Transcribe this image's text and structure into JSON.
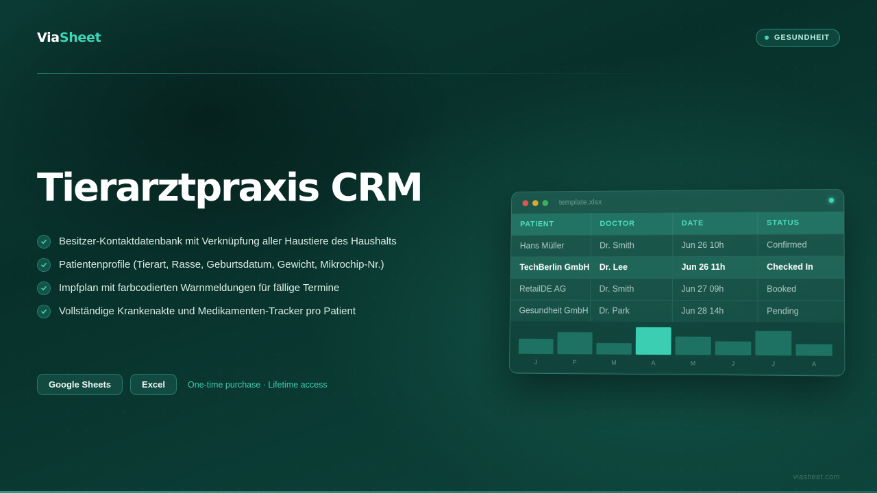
{
  "brand": {
    "part1": "Via",
    "part2": "Sheet"
  },
  "category_badge": "GESUNDHEIT",
  "hero": {
    "title": "Tierarztpraxis CRM"
  },
  "features": [
    "Besitzer-Kontaktdatenbank mit Verknüpfung aller Haustiere des Haushalts",
    "Patientenprofile (Tierart, Rasse, Geburtsdatum, Gewicht, Mikrochip-Nr.)",
    "Impfplan mit farbcodierten Warnmeldungen für fällige Termine",
    "Vollständige Krankenakte und Medikamenten-Tracker pro Patient"
  ],
  "cta": {
    "google_sheets": "Google Sheets",
    "excel": "Excel",
    "note": "One-time purchase · Lifetime access"
  },
  "preview": {
    "filename": "template.xlsx",
    "columns": [
      "PATIENT",
      "DOCTOR",
      "DATE",
      "STATUS"
    ],
    "rows": [
      [
        "Hans Müller",
        "Dr. Smith",
        "Jun 26 10h",
        "Confirmed"
      ],
      [
        "TechBerlin GmbH",
        "Dr. Lee",
        "Jun 26 11h",
        "Checked In"
      ],
      [
        "RetailDE AG",
        "Dr. Smith",
        "Jun 27 09h",
        "Booked"
      ],
      [
        "Gesundheit GmbH",
        "Dr. Park",
        "Jun 28 14h",
        "Pending"
      ]
    ],
    "highlight_row": 1,
    "chart_data": {
      "type": "bar",
      "categories": [
        "J",
        "F",
        "M",
        "A",
        "M",
        "J",
        "J",
        "A"
      ],
      "values": [
        20,
        29,
        15,
        36,
        24,
        18,
        32,
        15
      ],
      "highlight_index": 3,
      "colors": {
        "bar": "#1f7a6a",
        "highlight": "#3fd6b8"
      }
    }
  },
  "footer": {
    "domain": "viasheet.com"
  },
  "colors": {
    "accent": "#3fd6b8",
    "background": "#08302a"
  }
}
